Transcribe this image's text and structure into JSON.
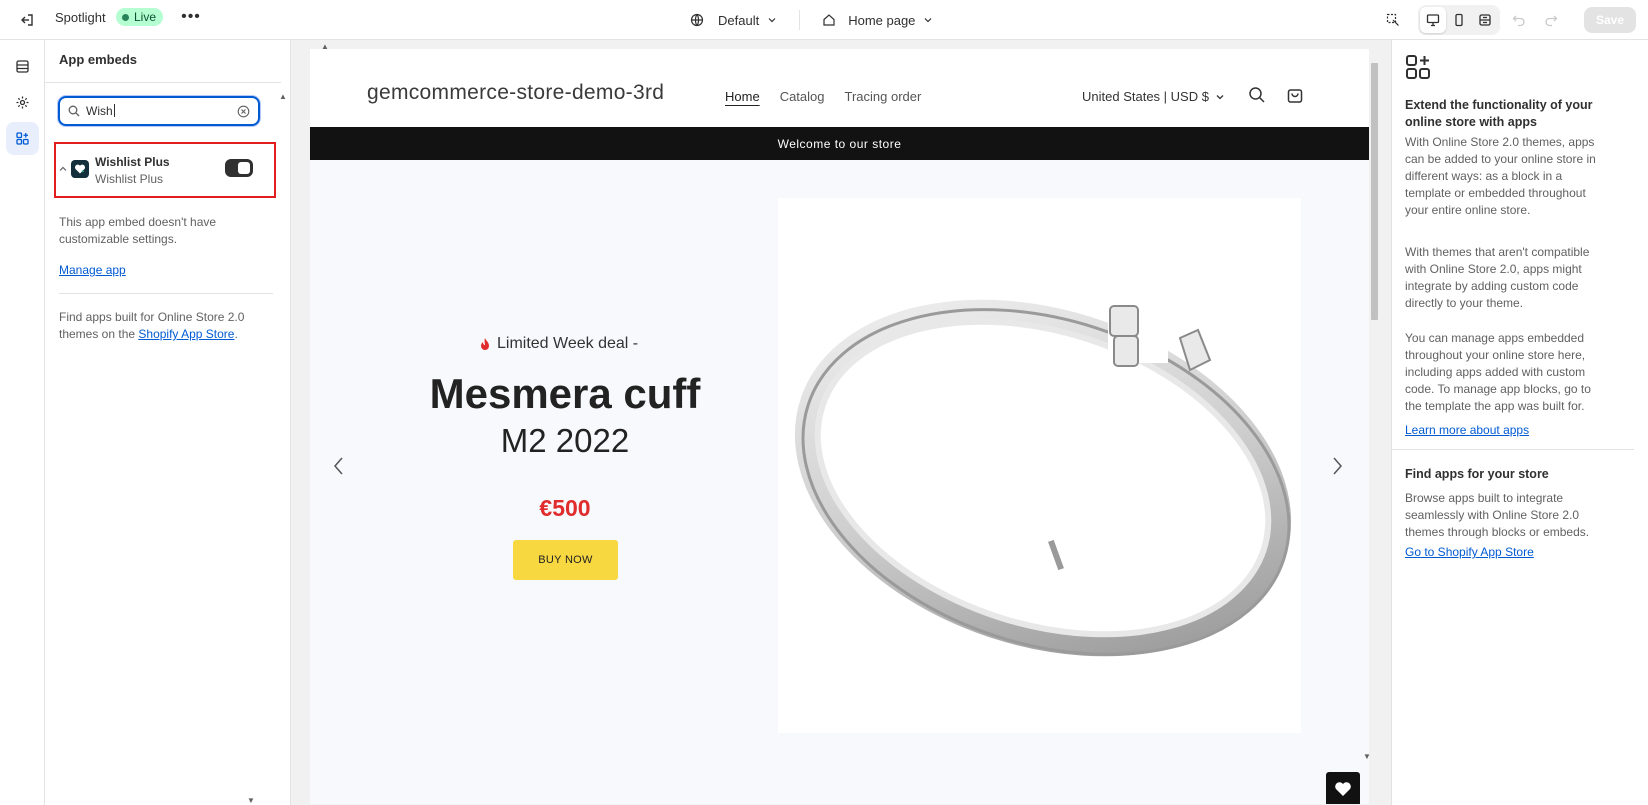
{
  "topbar": {
    "theme_name": "Spotlight",
    "status": "Live",
    "more": "•••",
    "view_select": "Default",
    "page_select": "Home page",
    "save": "Save"
  },
  "panel": {
    "title": "App embeds",
    "search_value": "Wish",
    "app": {
      "name": "Wishlist Plus",
      "provider": "Wishlist Plus",
      "enabled": true
    },
    "note": "This app embed doesn't have customizable settings.",
    "manage": "Manage app",
    "find_prefix": "Find apps built for Online Store 2.0 themes on the ",
    "find_link": "Shopify App Store",
    "find_suffix": "."
  },
  "preview": {
    "store_name": "gemcommerce-store-demo-3rd",
    "nav": [
      "Home",
      "Catalog",
      "Tracing order"
    ],
    "locale": "United States | USD $",
    "announcement": "Welcome to our store",
    "hero": {
      "tag": "Limited Week deal -",
      "title": "Mesmera cuff",
      "subtitle": "M2 2022",
      "price": "€500",
      "button": "BUY NOW"
    }
  },
  "rpanel": {
    "heading1": "Extend the functionality of your online store with apps",
    "para1": "With Online Store 2.0 themes, apps can be added to your online store in different ways: as a block in a template or embedded throughout your entire online store.",
    "para2": "With themes that aren't compatible with Online Store 2.0, apps might integrate by adding custom code directly to your theme.",
    "para3": "You can manage apps embedded throughout your online store here, including apps added with custom code. To manage app blocks, go to the template the app was built for.",
    "link1": "Learn more about apps",
    "heading2": "Find apps for your store",
    "para4": "Browse apps built to integrate seamlessly with Online Store 2.0 themes through blocks or embeds.",
    "link2": "Go to Shopify App Store"
  },
  "colors": {
    "accent": "#005bd3",
    "highlight": "#e11d1d",
    "price": "#e02c2c",
    "buy_button": "#f7d841"
  }
}
